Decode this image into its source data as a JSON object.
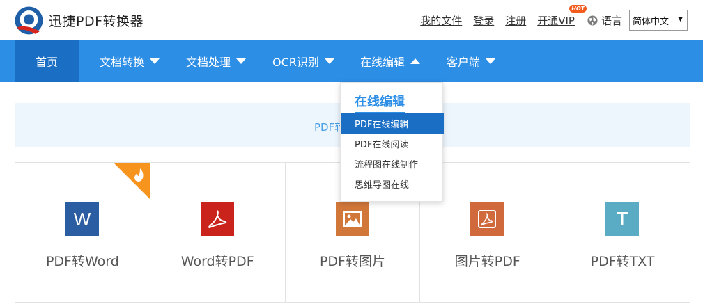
{
  "header": {
    "app_title": "迅捷PDF转换器",
    "links": [
      "我的文件",
      "登录",
      "注册",
      "开通VIP"
    ],
    "hot_badge": "HOT",
    "lang_label": "语言",
    "lang_selected": "简体中文"
  },
  "nav": {
    "items": [
      {
        "label": "首页"
      },
      {
        "label": "文档转换"
      },
      {
        "label": "文档处理"
      },
      {
        "label": "OCR识别"
      },
      {
        "label": "在线编辑"
      },
      {
        "label": "客户端"
      }
    ]
  },
  "banner": {
    "text": "PDF转"
  },
  "dropdown": {
    "title": "在线编辑",
    "items": [
      "PDF在线编辑",
      "PDF在线阅读",
      "流程图在线制作",
      "思维导图在线"
    ]
  },
  "cards": [
    {
      "label": "PDF转Word",
      "icon": "word-icon",
      "icon_text": "W",
      "color": "#2b5da3"
    },
    {
      "label": "Word转PDF",
      "icon": "pdf-icon",
      "color": "#c9231b"
    },
    {
      "label": "PDF转图片",
      "icon": "image-icon",
      "color": "#d2773a"
    },
    {
      "label": "图片转PDF",
      "icon": "pdf-icon",
      "color": "#d06a3c"
    },
    {
      "label": "PDF转TXT",
      "icon": "txt-icon",
      "icon_text": "T",
      "color": "#5aacc4"
    }
  ],
  "colors": {
    "nav": "#2d8ee6",
    "nav_active": "#1a6fc5",
    "hot": "#f7941e"
  }
}
